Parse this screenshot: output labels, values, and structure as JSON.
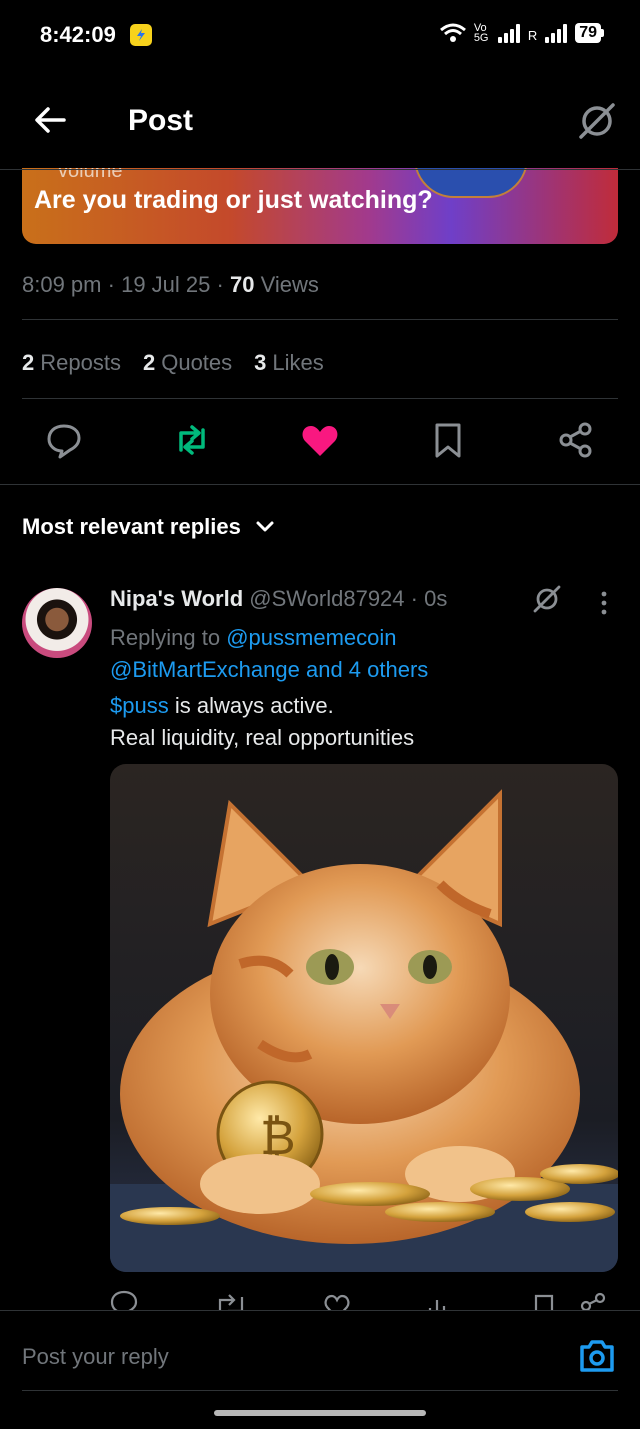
{
  "status_bar": {
    "time": "8:42:09",
    "network_label": "Vo 5G",
    "roaming": "R",
    "battery": "79"
  },
  "header": {
    "title": "Post"
  },
  "banner": {
    "cut_text": "volume",
    "text": "Are you trading or just watching?"
  },
  "post_meta": {
    "time": "8:09 pm",
    "date": "19 Jul 25",
    "views_count": "70",
    "views_label": "Views"
  },
  "stats": {
    "reposts_count": "2",
    "reposts_label": "Reposts",
    "quotes_count": "2",
    "quotes_label": "Quotes",
    "likes_count": "3",
    "likes_label": "Likes"
  },
  "colors": {
    "like": "#f91880",
    "repost": "#00ba7c",
    "link": "#1d9bf0"
  },
  "sort": {
    "label": "Most relevant replies"
  },
  "reply": {
    "name": "Nipa's World",
    "handle": "@SWorld87924",
    "time": "0s",
    "replying_to_label": "Replying to",
    "replying_to_1": "@pussmemecoin",
    "replying_to_2": "@BitMartExchange and 4 others",
    "cashtag": "$puss",
    "text_1": " is always active.",
    "text_2": "Real liquidity, real opportunities"
  },
  "reply_box": {
    "placeholder": "Post your reply"
  }
}
